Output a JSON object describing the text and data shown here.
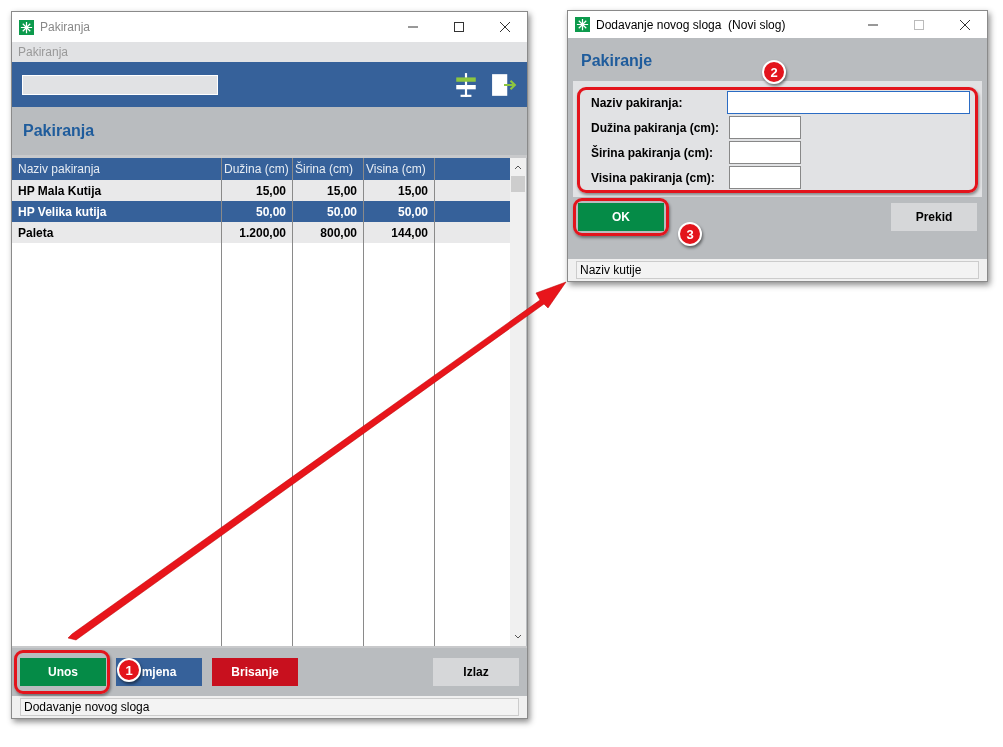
{
  "main_window": {
    "title": "Pakiranja",
    "menu": [
      "Pakiranja"
    ],
    "heading": "Pakiranja",
    "table": {
      "columns": [
        "Naziv pakiranja",
        "Dužina (cm)",
        "Širina (cm)",
        "Visina (cm)"
      ],
      "rows": [
        {
          "cells": [
            "HP Mala Kutija",
            "15,00",
            "15,00",
            "15,00"
          ],
          "selected": false
        },
        {
          "cells": [
            "HP Velika kutija",
            "50,00",
            "50,00",
            "50,00"
          ],
          "selected": true
        },
        {
          "cells": [
            "Paleta",
            "1.200,00",
            "800,00",
            "144,00"
          ],
          "selected": false
        }
      ]
    },
    "buttons": [
      {
        "label": "Unos",
        "kind": "green"
      },
      {
        "label": "mjena",
        "kind": "blue"
      },
      {
        "label": "Brisanje",
        "kind": "red"
      },
      {
        "label": "Izlaz",
        "kind": "plain"
      }
    ],
    "status_bar": "Dodavanje novog sloga"
  },
  "dialog": {
    "title": "Dodavanje novog sloga  (Novi slog)",
    "heading": "Pakiranje",
    "fields": [
      {
        "label": "Naziv pakiranja:",
        "wide": true
      },
      {
        "label": "Dužina pakiranja (cm):",
        "wide": false
      },
      {
        "label": "Širina pakiranja (cm):",
        "wide": false
      },
      {
        "label": "Visina pakiranja (cm):",
        "wide": false
      }
    ],
    "buttons": [
      {
        "label": "OK",
        "kind": "green"
      },
      {
        "label": "Prekid",
        "kind": "plain"
      }
    ],
    "status_bar": "Naziv kutije"
  },
  "annotations": [
    "1",
    "2",
    "3"
  ]
}
